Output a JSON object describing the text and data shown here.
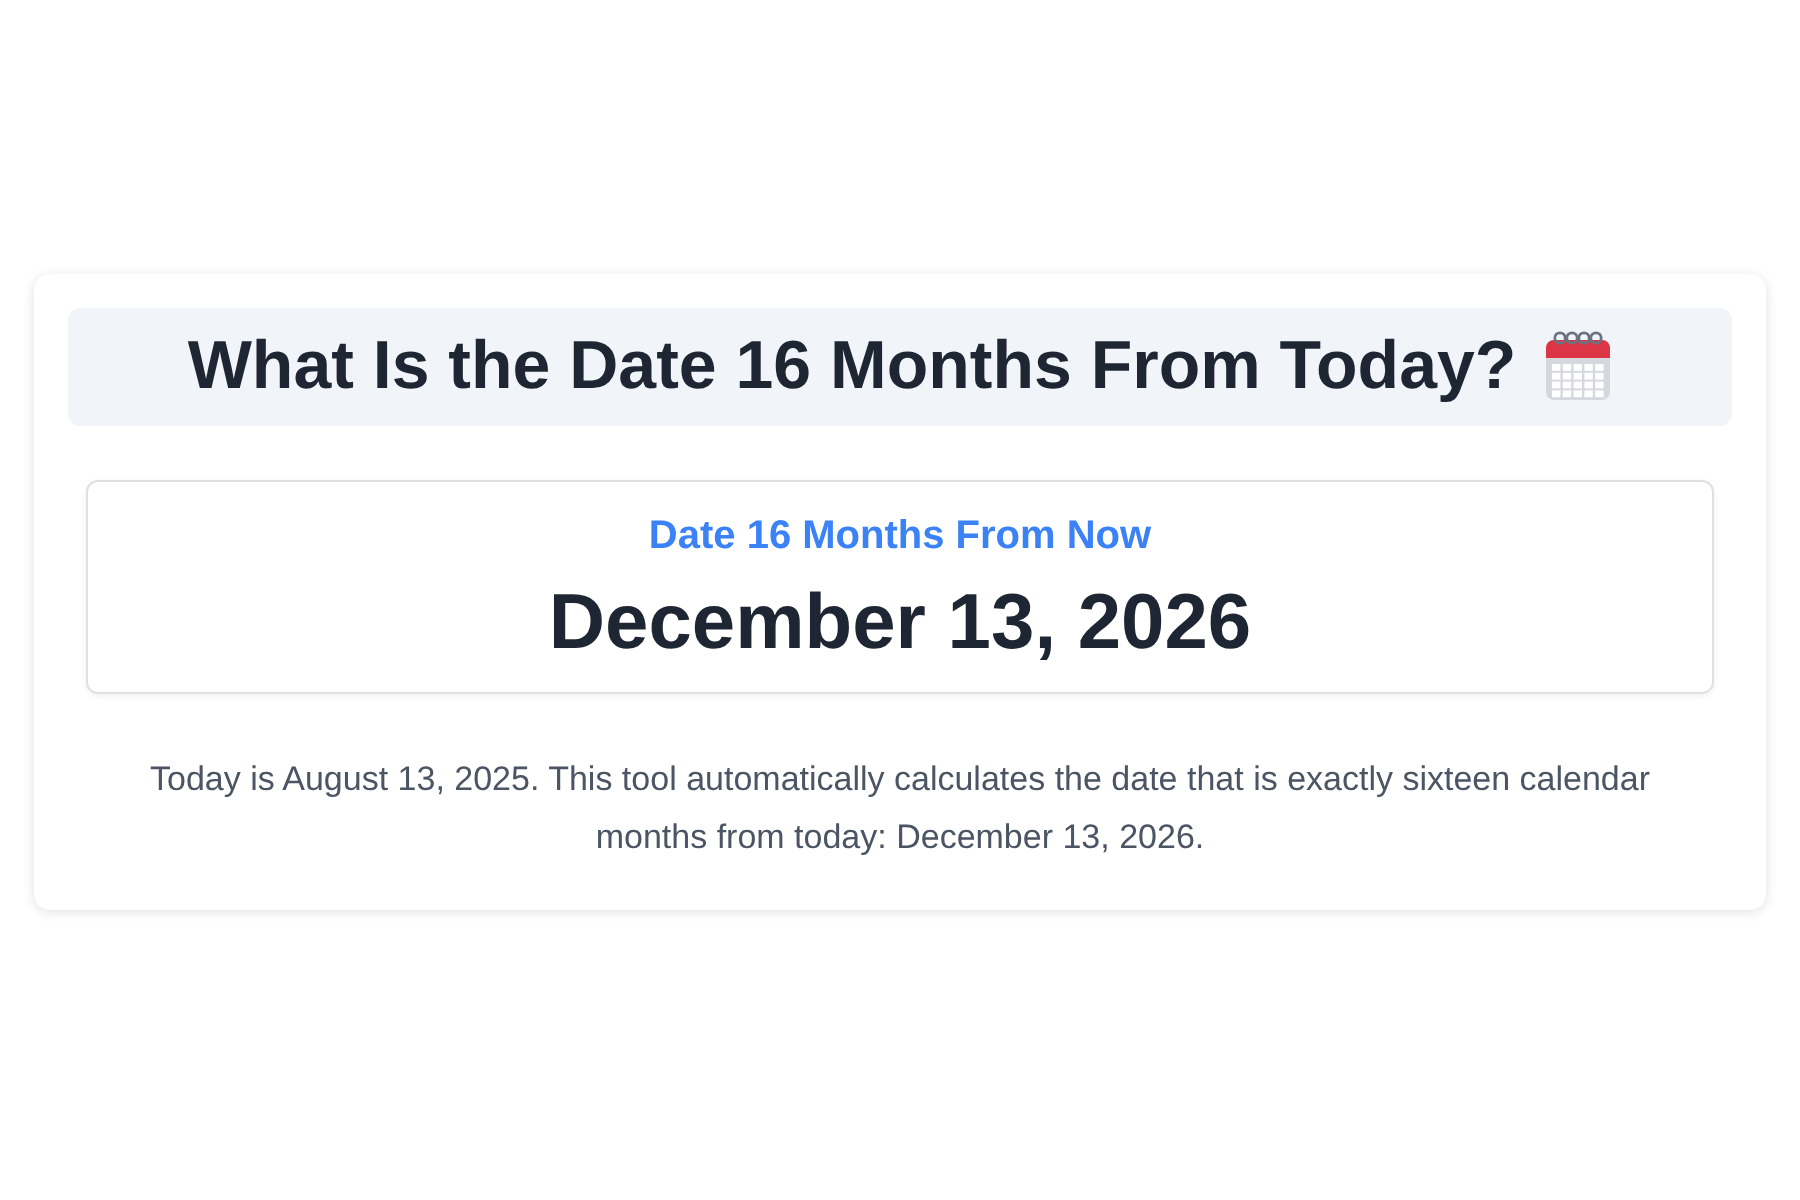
{
  "heading": {
    "title": "What Is the Date 16 Months From Today?"
  },
  "result": {
    "label": "Date 16 Months From Now",
    "date": "December 13, 2026"
  },
  "description": "Today is August 13, 2025. This tool automatically calculates the date that is exactly sixteen calendar months from today: December 13, 2026."
}
